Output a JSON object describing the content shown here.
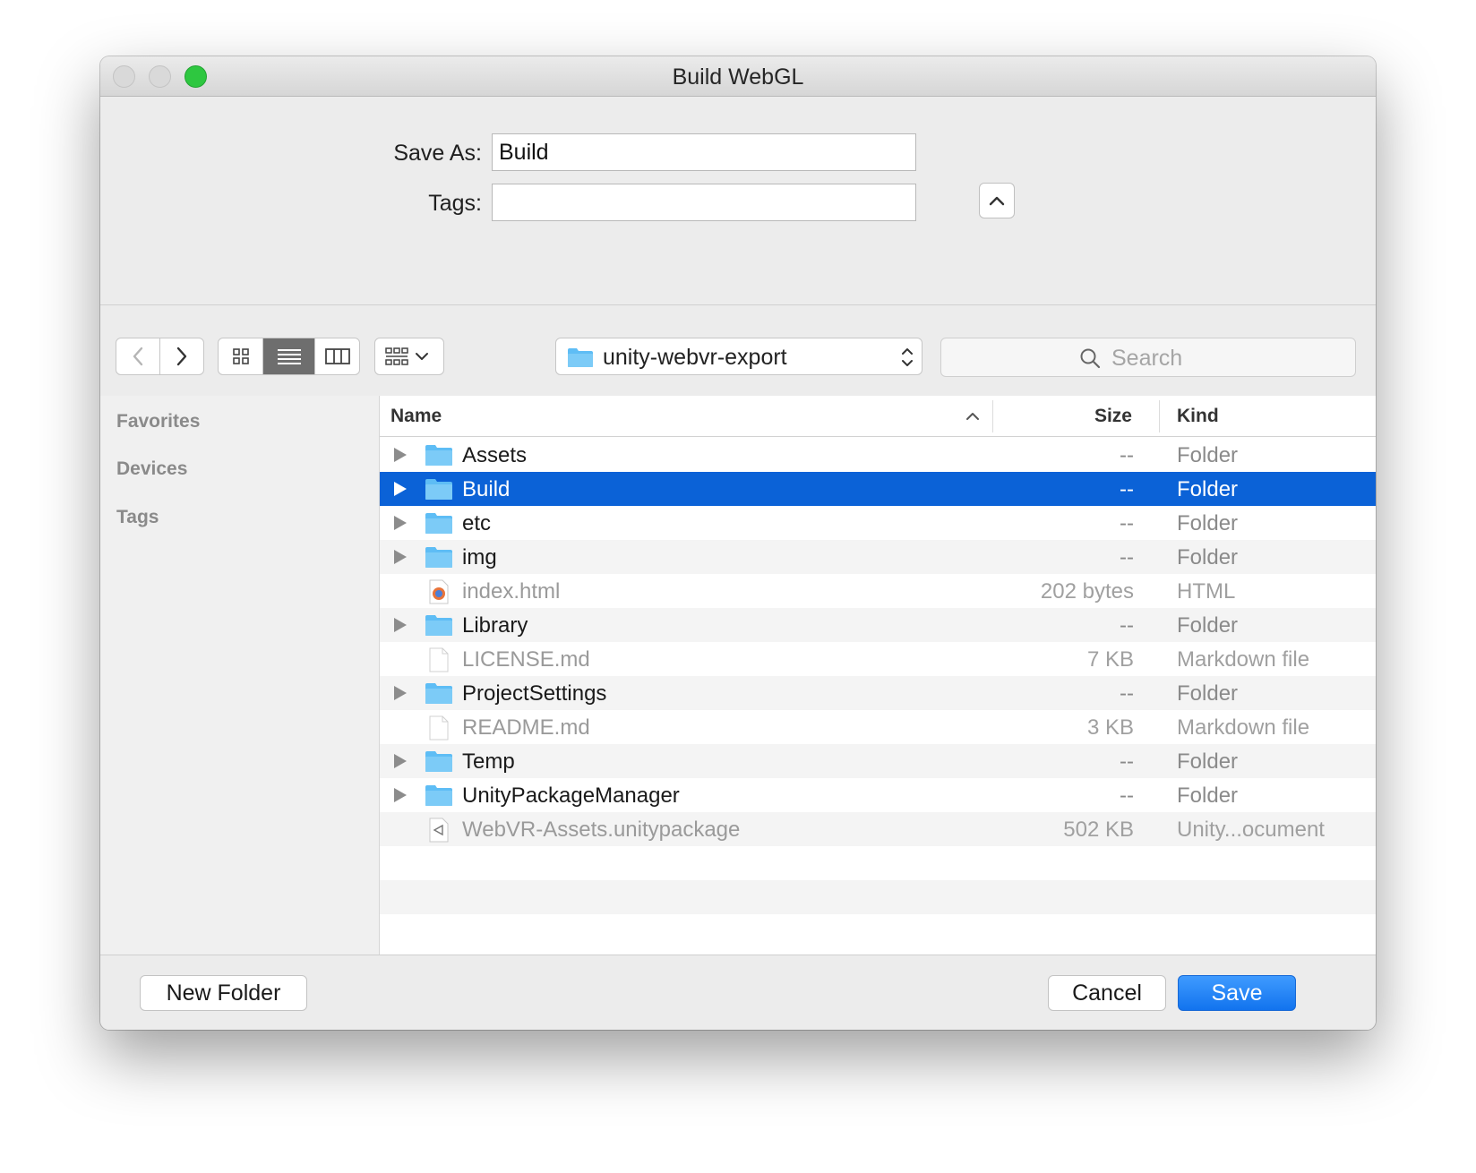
{
  "window": {
    "title": "Build WebGL"
  },
  "form": {
    "save_as_label": "Save As:",
    "save_as_value": "Build",
    "tags_label": "Tags:",
    "tags_value": ""
  },
  "toolbar": {
    "back_icon": "chevron-left-icon",
    "forward_icon": "chevron-right-icon",
    "views": [
      "icon-view",
      "list-view",
      "column-view"
    ],
    "active_view": "list-view",
    "arrange_icon": "group-grid-icon",
    "path": "unity-webvr-export",
    "search_placeholder": "Search"
  },
  "sidebar": {
    "items": [
      {
        "label": "Favorites"
      },
      {
        "label": "Devices"
      },
      {
        "label": "Tags"
      }
    ]
  },
  "columns": {
    "name": "Name",
    "size": "Size",
    "kind": "Kind"
  },
  "files": [
    {
      "name": "Assets",
      "size": "--",
      "kind": "Folder",
      "type": "folder",
      "selected": false
    },
    {
      "name": "Build",
      "size": "--",
      "kind": "Folder",
      "type": "folder",
      "selected": true
    },
    {
      "name": "etc",
      "size": "--",
      "kind": "Folder",
      "type": "folder",
      "selected": false
    },
    {
      "name": "img",
      "size": "--",
      "kind": "Folder",
      "type": "folder",
      "selected": false
    },
    {
      "name": "index.html",
      "size": "202 bytes",
      "kind": "HTML",
      "type": "html",
      "selected": false
    },
    {
      "name": "Library",
      "size": "--",
      "kind": "Folder",
      "type": "folder",
      "selected": false
    },
    {
      "name": "LICENSE.md",
      "size": "7 KB",
      "kind": "Markdown file",
      "type": "doc",
      "selected": false
    },
    {
      "name": "ProjectSettings",
      "size": "--",
      "kind": "Folder",
      "type": "folder",
      "selected": false
    },
    {
      "name": "README.md",
      "size": "3 KB",
      "kind": "Markdown file",
      "type": "doc",
      "selected": false
    },
    {
      "name": "Temp",
      "size": "--",
      "kind": "Folder",
      "type": "folder",
      "selected": false
    },
    {
      "name": "UnityPackageManager",
      "size": "--",
      "kind": "Folder",
      "type": "folder",
      "selected": false
    },
    {
      "name": "WebVR-Assets.unitypackage",
      "size": "502 KB",
      "kind": "Unity...ocument",
      "type": "unity",
      "selected": false
    }
  ],
  "buttons": {
    "new_folder": "New Folder",
    "cancel": "Cancel",
    "save": "Save"
  },
  "colors": {
    "selection": "#0b62d7",
    "primary_button": "#1273ee",
    "folder": "#5ebdf5",
    "zoom_button": "#2ec740"
  }
}
